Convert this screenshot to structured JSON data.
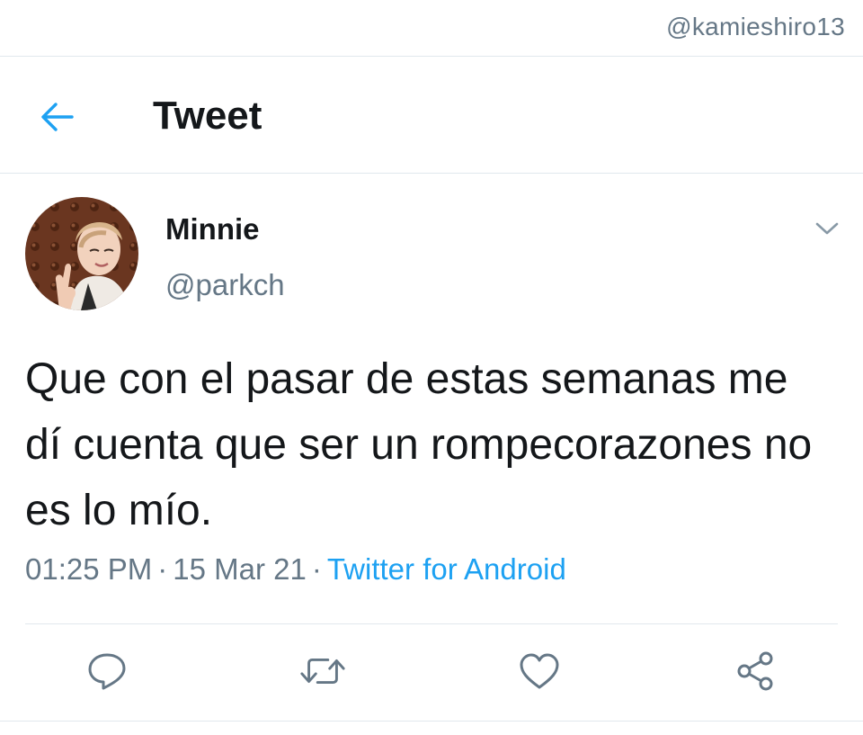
{
  "watermark": "@kamieshiro13",
  "header": {
    "title": "Tweet",
    "back_icon": "arrow-left-icon"
  },
  "colors": {
    "accent": "#1da1f2",
    "secondary_text": "#657786",
    "primary_text": "#14171a",
    "divider": "#e1e8ed"
  },
  "tweet": {
    "author_name": "Minnie",
    "author_handle": "@parkch",
    "text": "Que con el pasar de estas semanas me dí cuenta que ser un rompecorazones no es lo mío.",
    "time": "01:25 PM",
    "separator": "·",
    "date": "15 Mar 21",
    "source": "Twitter for Android"
  },
  "actions": [
    "reply-icon",
    "retweet-icon",
    "like-icon",
    "share-icon"
  ]
}
